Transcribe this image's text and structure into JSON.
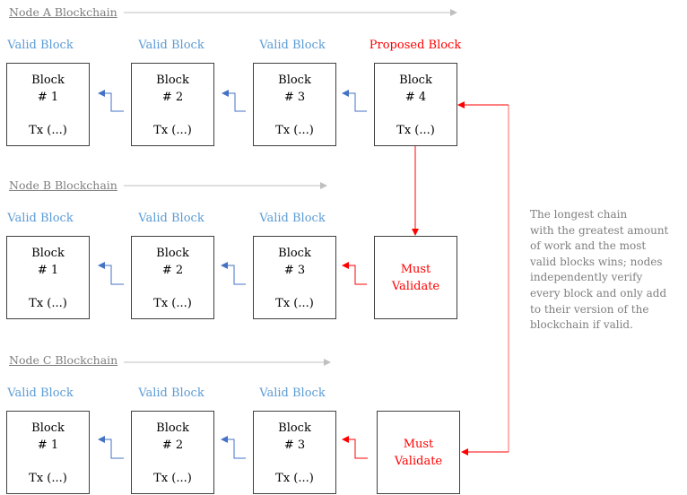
{
  "colors": {
    "valid_label": "#5b9bd5",
    "proposed": "#ff0000",
    "chain_arrow": "#bfbfbf",
    "link_arrow": "#4472c4",
    "block_border": "#404040",
    "note_text": "#7f7f7f"
  },
  "chains": [
    {
      "title": "Node A Blockchain",
      "blocks": [
        {
          "status": "Valid Block",
          "title": "Block",
          "number": "# 1",
          "tx": "Tx (...)"
        },
        {
          "status": "Valid Block",
          "title": "Block",
          "number": "# 2",
          "tx": "Tx (...)"
        },
        {
          "status": "Valid Block",
          "title": "Block",
          "number": "# 3",
          "tx": "Tx (...)"
        },
        {
          "status": "Proposed Block",
          "title": "Block",
          "number": "# 4",
          "tx": "Tx (...)"
        }
      ]
    },
    {
      "title": "Node B Blockchain",
      "blocks": [
        {
          "status": "Valid Block",
          "title": "Block",
          "number": "# 1",
          "tx": "Tx (...)"
        },
        {
          "status": "Valid Block",
          "title": "Block",
          "number": "# 2",
          "tx": "Tx (...)"
        },
        {
          "status": "Valid Block",
          "title": "Block",
          "number": "# 3",
          "tx": "Tx (...)"
        }
      ],
      "pending": {
        "line1": "Must",
        "line2": "Validate"
      }
    },
    {
      "title": "Node C Blockchain",
      "blocks": [
        {
          "status": "Valid Block",
          "title": "Block",
          "number": "# 1",
          "tx": "Tx (...)"
        },
        {
          "status": "Valid Block",
          "title": "Block",
          "number": "# 2",
          "tx": "Tx (...)"
        },
        {
          "status": "Valid Block",
          "title": "Block",
          "number": "# 3",
          "tx": "Tx (...)"
        }
      ],
      "pending": {
        "line1": "Must",
        "line2": "Validate"
      }
    }
  ],
  "note": {
    "lines": [
      "The longest chain",
      "with the greatest amount",
      "of work and the most",
      "valid blocks wins; nodes",
      "independently verify",
      "every block and only add",
      "to their version of the",
      "blockchain if valid."
    ]
  }
}
